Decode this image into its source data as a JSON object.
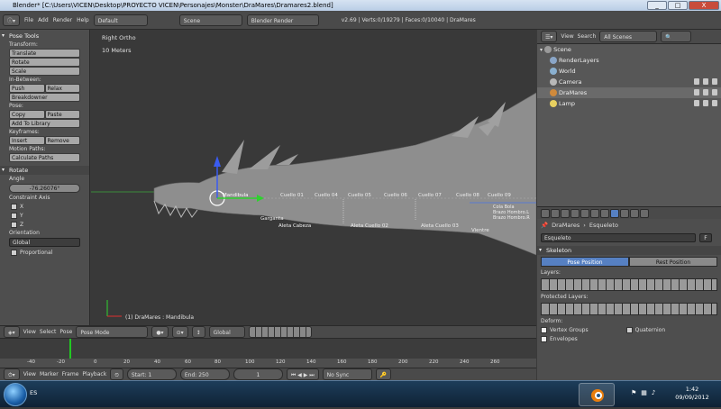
{
  "window": {
    "title": "Blender* [C:\\Users\\VICEN\\Desktop\\PROYECTO VICEN\\Personajes\\Monster\\DraMares\\Dramares2.blend]",
    "controls": [
      "_",
      "□",
      "X"
    ]
  },
  "infobar": {
    "menus": [
      "File",
      "Add",
      "Render",
      "Help"
    ],
    "screen_layout": "Default",
    "scene": "Scene",
    "engine": "Blender Render",
    "stats": "v2.69 | Verts:0/19279 | Faces:0/10040 | DraMares"
  },
  "toolshelf": {
    "title": "Pose Tools",
    "sections": {
      "transform": {
        "label": "Transform:",
        "buttons": [
          "Translate",
          "Rotate",
          "Scale"
        ]
      },
      "in_between": {
        "label": "In-Between:",
        "row": [
          "Push",
          "Relax"
        ],
        "extra": "Breakdowner"
      },
      "pose": {
        "label": "Pose:",
        "row": [
          "Copy",
          "Paste"
        ],
        "extra": "Add To Library"
      },
      "keyframes": {
        "label": "Keyframes:",
        "row": [
          "Insert",
          "Remove"
        ]
      },
      "motion_paths": {
        "label": "Motion Paths:",
        "button": "Calculate Paths"
      }
    },
    "rotate_panel": {
      "title": "Rotate",
      "angle_label": "Angle",
      "angle_value": "-76.26076°",
      "constraint_label": "Constraint Axis",
      "axes": [
        "X",
        "Y",
        "Z"
      ],
      "orientation_label": "Orientation",
      "orientation_value": "Global",
      "extra": "Proportional"
    }
  },
  "viewport": {
    "view_label": "Right Ortho",
    "scale_label": "10 Meters",
    "object_label": "(1) DraMares : Mandibula",
    "bone_labels": [
      "Mandibula",
      "Cuello 01",
      "Cuello 04",
      "Cuello 05",
      "Cuello 06",
      "Cuello 07",
      "Cuello 08",
      "Cuello 09"
    ],
    "bone_labels_low": [
      "Garganta",
      "Aleta Cabeza",
      "Aleta Cuello 02",
      "Aleta Cuello 03",
      "Vientre"
    ],
    "bone_labels_right": [
      "Cola Bola",
      "Brazo Hombro.L",
      "Brazo Hombro.R"
    ]
  },
  "viewport_header": {
    "menus": [
      "View",
      "Select",
      "Pose"
    ],
    "mode": "Pose Mode",
    "orientation": "Global"
  },
  "timeline": {
    "ticks": [
      "-40",
      "-20",
      "0",
      "20",
      "40",
      "60",
      "80",
      "100",
      "120",
      "140",
      "160",
      "180",
      "200",
      "220",
      "240",
      "260"
    ],
    "current_frame_marker": "0"
  },
  "timeline_header": {
    "menus": [
      "View",
      "Marker",
      "Frame",
      "Playback"
    ],
    "start": "Start: 1",
    "end": "End: 250",
    "current": "1",
    "sync": "No Sync"
  },
  "outliner": {
    "header_menus": [
      "View",
      "Search"
    ],
    "filter": "All Scenes",
    "items": [
      {
        "label": "Scene",
        "indent": 0,
        "icon_color": "#9a9a9a"
      },
      {
        "label": "RenderLayers",
        "indent": 1,
        "icon_color": "#8aa6c8"
      },
      {
        "label": "World",
        "indent": 1,
        "icon_color": "#8ab0d0"
      },
      {
        "label": "Camera",
        "indent": 1,
        "icon_color": "#b8b8b8"
      },
      {
        "label": "DraMares",
        "indent": 1,
        "icon_color": "#d08a3c"
      },
      {
        "label": "Lamp",
        "indent": 1,
        "icon_color": "#e8d060"
      }
    ]
  },
  "properties": {
    "context_object": "DraMares",
    "context_data": "Esqueleto",
    "datablock": "Esqueleto",
    "datablock_users": "F",
    "skeleton_title": "Skeleton",
    "pose_position": "Pose Position",
    "rest_position": "Rest Position",
    "layers_label": "Layers:",
    "protected_layers_label": "Protected Layers:",
    "deform_label": "Deform:",
    "deform_options": [
      "Vertex Groups",
      "Envelopes",
      "Quaternion"
    ]
  },
  "taskbar": {
    "lang": "ES",
    "time": "1:42",
    "date": "09/09/2012"
  },
  "colors": {
    "bone_green": "#2ed22e",
    "axis_blue": "#3a5cf0",
    "pose_button": "#5680c2",
    "timeline_current": "#22c822"
  }
}
